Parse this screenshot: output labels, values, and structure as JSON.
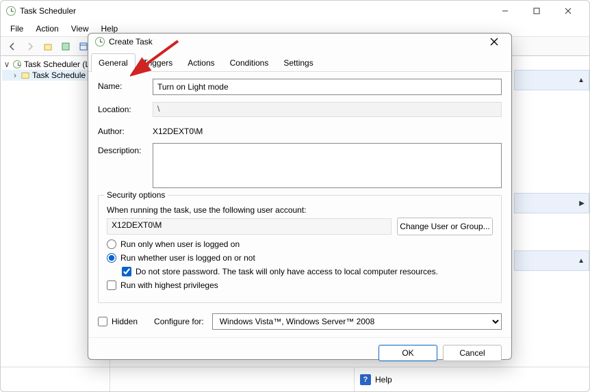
{
  "window": {
    "title": "Task Scheduler",
    "menu": [
      "File",
      "Action",
      "View",
      "Help"
    ]
  },
  "tree": {
    "root": "Task Scheduler (L",
    "child": "Task Schedule"
  },
  "statusbar": {
    "help": "Help"
  },
  "dialog": {
    "title": "Create Task",
    "tabs": [
      "General",
      "Triggers",
      "Actions",
      "Conditions",
      "Settings"
    ],
    "labels": {
      "name": "Name:",
      "location": "Location:",
      "author": "Author:",
      "description": "Description:"
    },
    "values": {
      "name": "Turn on Light mode",
      "location": "\\",
      "author": "X12DEXT0\\M",
      "description": ""
    },
    "security": {
      "legend": "Security options",
      "prompt": "When running the task, use the following user account:",
      "user": "X12DEXT0\\M",
      "changeBtn": "Change User or Group...",
      "radio1": "Run only when user is logged on",
      "radio2": "Run whether user is logged on or not",
      "noPass": "Do not store password.  The task will only have access to local computer resources.",
      "highest": "Run with highest privileges"
    },
    "bottom": {
      "hidden": "Hidden",
      "configure": "Configure for:",
      "selected": "Windows Vista™, Windows Server™ 2008"
    },
    "buttons": {
      "ok": "OK",
      "cancel": "Cancel"
    }
  }
}
